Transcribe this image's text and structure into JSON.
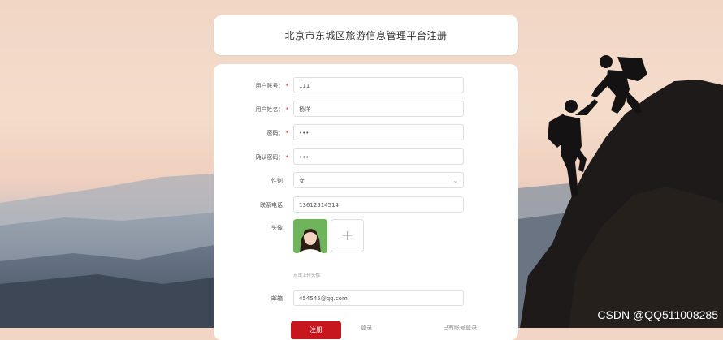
{
  "title": "北京市东城区旅游信息管理平台注册",
  "form": {
    "account": {
      "label": "用户账号：",
      "required": true,
      "value": "111"
    },
    "name": {
      "label": "用户姓名：",
      "required": true,
      "value": "杨洋"
    },
    "password": {
      "label": "密码：",
      "required": true,
      "value": "•••"
    },
    "confirm": {
      "label": "确认密码：",
      "required": true,
      "value": "•••"
    },
    "gender": {
      "label": "性别：",
      "value": "女"
    },
    "phone": {
      "label": "联系电话：",
      "value": "13612514514"
    },
    "avatar": {
      "label": "头像：",
      "hint": "点击上传头像"
    },
    "email": {
      "label": "邮箱：",
      "value": "454545@qq.com"
    }
  },
  "buttons": {
    "register": "注册",
    "login": "登录",
    "forgot": "已有账号登录"
  },
  "required_mark": "*",
  "watermark": "CSDN @QQ511008285",
  "colors": {
    "primary": "#c8161e",
    "required": "#e02020"
  }
}
